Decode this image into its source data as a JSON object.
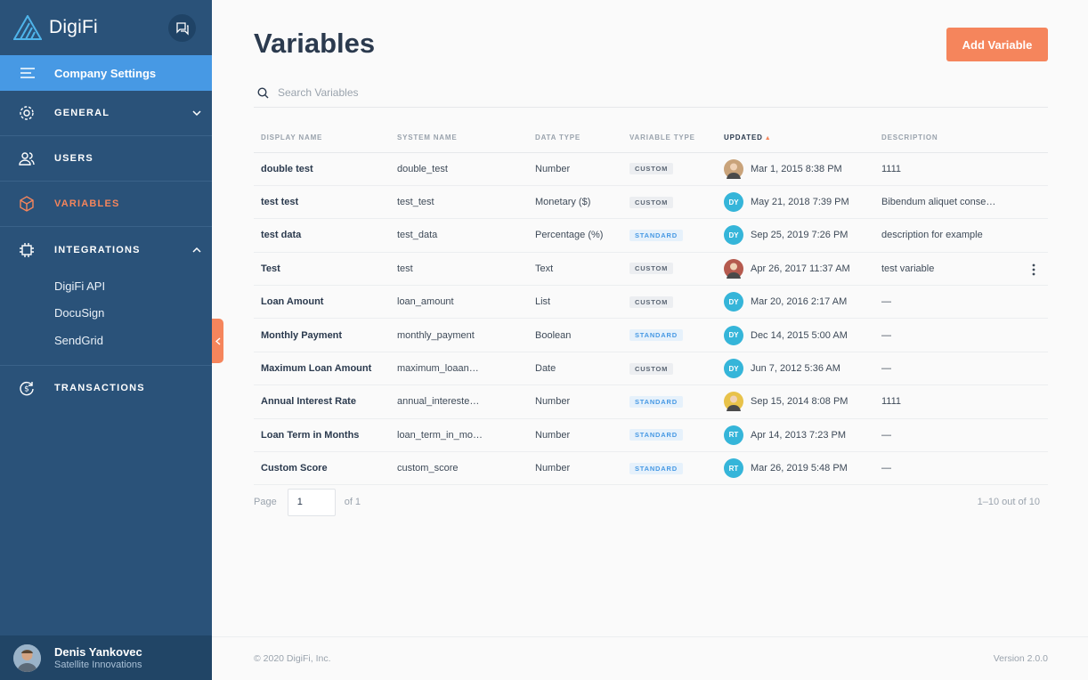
{
  "brand": {
    "name": "DigiFi"
  },
  "sidebar": {
    "company_settings": "Company Settings",
    "nav": {
      "general": "GENERAL",
      "users": "USERS",
      "variables": "VARIABLES",
      "integrations": "INTEGRATIONS",
      "transactions": "TRANSACTIONS"
    },
    "integrations_items": [
      "DigiFi API",
      "DocuSign",
      "SendGrid"
    ],
    "user": {
      "name": "Denis Yankovec",
      "company": "Satellite Innovations"
    }
  },
  "colors": {
    "sidebar": "#2a5279",
    "accent": "#f5855c",
    "active_blue": "#4799e4",
    "avatar_teal": "#35b5d9"
  },
  "main": {
    "title": "Variables",
    "add_button": "Add Variable",
    "search_placeholder": "Search Variables",
    "columns": [
      "DISPLAY NAME",
      "SYSTEM NAME",
      "DATA TYPE",
      "VARIABLE TYPE",
      "UPDATED",
      "DESCRIPTION"
    ],
    "rows": [
      {
        "display": "double test",
        "system": "double_test",
        "type": "Number",
        "vtype": "CUSTOM",
        "avatar": "photo",
        "initials": "",
        "updated": "Mar 1, 2015 8:38 PM",
        "desc": "1111"
      },
      {
        "display": "test test",
        "system": "test_test",
        "type": "Monetary ($)",
        "vtype": "CUSTOM",
        "avatar": "initials",
        "initials": "DY",
        "updated": "May 21, 2018 7:39 PM",
        "desc": "Bibendum aliquet conse…"
      },
      {
        "display": "test data",
        "system": "test_data",
        "type": "Percentage (%)",
        "vtype": "STANDARD",
        "avatar": "initials",
        "initials": "DY",
        "updated": "Sep 25, 2019 7:26 PM",
        "desc": "description for example"
      },
      {
        "display": "Test",
        "system": "test",
        "type": "Text",
        "vtype": "CUSTOM",
        "avatar": "photo",
        "initials": "",
        "updated": "Apr 26, 2017 11:37 AM",
        "desc": "test variable"
      },
      {
        "display": "Loan Amount",
        "system": "loan_amount",
        "type": "List",
        "vtype": "CUSTOM",
        "avatar": "initials",
        "initials": "DY",
        "updated": "Mar 20, 2016 2:17 AM",
        "desc": "—"
      },
      {
        "display": "Monthly Payment",
        "system": "monthly_payment",
        "type": "Boolean",
        "vtype": "STANDARD",
        "avatar": "initials",
        "initials": "DY",
        "updated": "Dec 14, 2015 5:00 AM",
        "desc": "—"
      },
      {
        "display": "Maximum Loan Amount",
        "system": "maximum_loaan…",
        "type": "Date",
        "vtype": "CUSTOM",
        "avatar": "initials",
        "initials": "DY",
        "updated": "Jun 7, 2012 5:36 AM",
        "desc": "—"
      },
      {
        "display": "Annual Interest Rate",
        "system": "annual_intereste…",
        "type": "Number",
        "vtype": "STANDARD",
        "avatar": "photo",
        "initials": "",
        "updated": "Sep 15, 2014 8:08 PM",
        "desc": "1111"
      },
      {
        "display": "Loan Term in Months",
        "system": "loan_term_in_mo…",
        "type": "Number",
        "vtype": "STANDARD",
        "avatar": "initials",
        "initials": "RT",
        "updated": "Apr 14, 2013 7:23 PM",
        "desc": "—"
      },
      {
        "display": "Custom Score",
        "system": "custom_score",
        "type": "Number",
        "vtype": "STANDARD",
        "avatar": "initials",
        "initials": "RT",
        "updated": "Mar 26, 2019 5:48 PM",
        "desc": "—"
      }
    ],
    "pager": {
      "page_label": "Page",
      "page_value": "1",
      "of_label": "of 1",
      "count": "1–10 out of 10"
    }
  },
  "footer": {
    "copyright": "© 2020 DigiFi, Inc.",
    "version": "Version 2.0.0"
  }
}
